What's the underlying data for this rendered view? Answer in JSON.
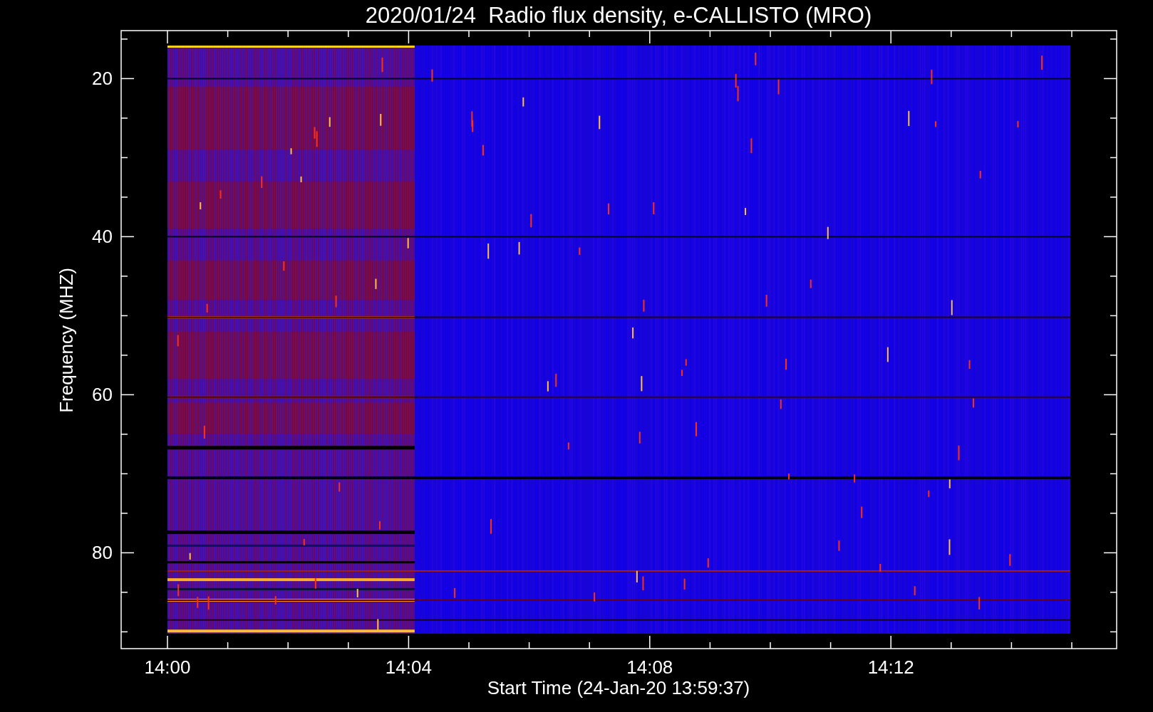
{
  "plot": {
    "title": "2020/01/24  Radio flux density, e-CALLISTO (MRO)",
    "xlabel": "Start Time (24-Jan-20 13:59:37)",
    "ylabel": "Frequency (MHZ)",
    "xticks": [
      "14:00",
      "14:04",
      "14:08",
      "14:12"
    ],
    "yticks": [
      "20",
      "40",
      "60",
      "80"
    ]
  }
}
